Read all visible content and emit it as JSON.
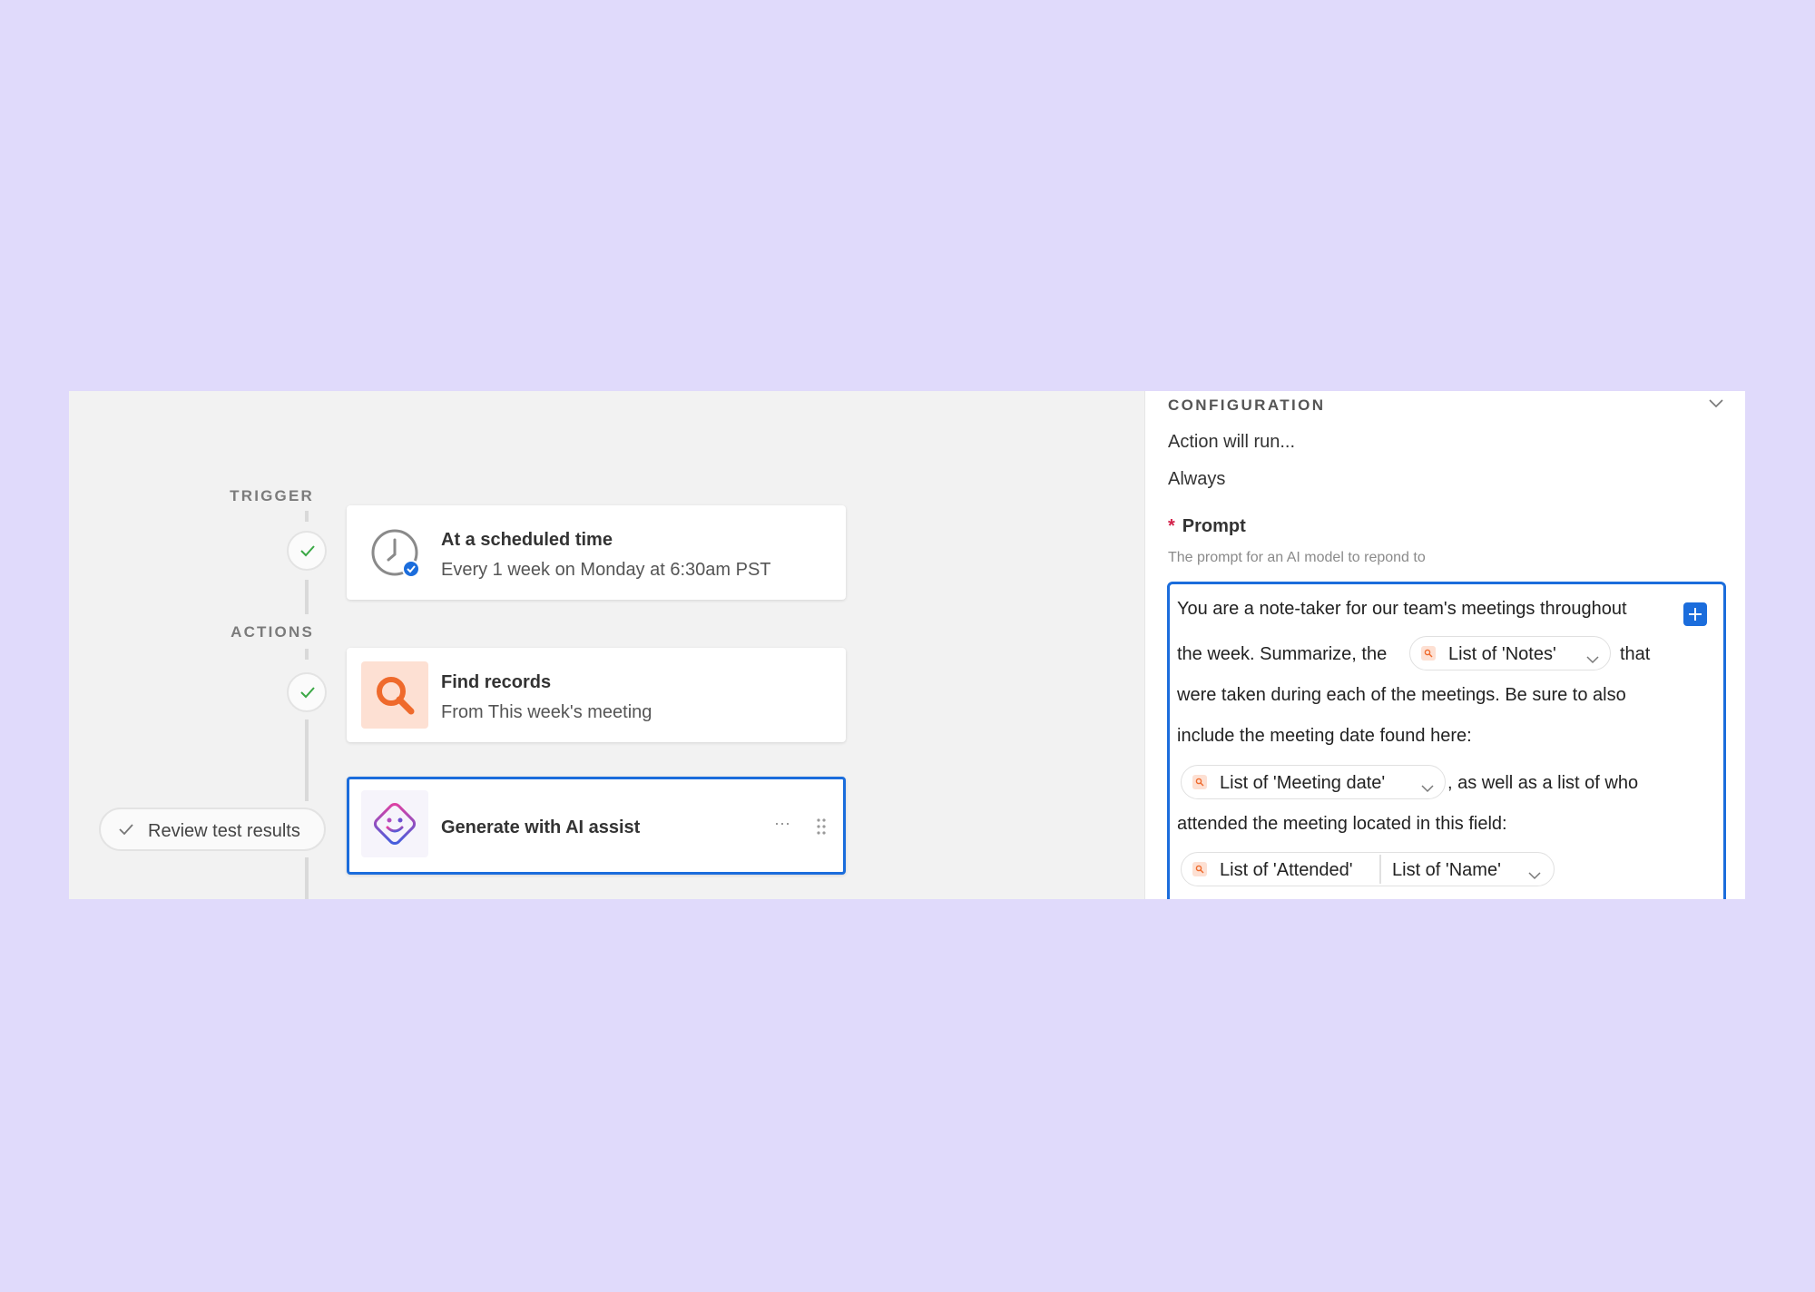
{
  "workflow": {
    "trigger_label": "TRIGGER",
    "actions_label": "ACTIONS",
    "trigger_card": {
      "title": "At a scheduled time",
      "subtitle": "Every 1 week on Monday at 6:30am PST",
      "icon": "clock-icon"
    },
    "find_card": {
      "title": "Find records",
      "subtitle": "From This week's meeting",
      "icon": "search-icon"
    },
    "ai_card": {
      "title": "Generate with AI assist",
      "icon": "ai-smile-icon",
      "more": "···"
    },
    "review_button": "Review test results"
  },
  "panel": {
    "section_title": "CONFIGURATION",
    "run_label": "Action will run...",
    "run_value": "Always",
    "prompt_required": "*",
    "prompt_label": "Prompt",
    "prompt_help": "The prompt for an AI model to repond to",
    "prompt_lines": {
      "l1": "You are a note-taker for our team's meetings throughout",
      "l2a": "the week. Summarize, the",
      "l2b": "that",
      "l3": "were taken during each of the meetings. Be sure to also",
      "l4": "include the meeting date found here:",
      "l5b": ", as well as a list of who",
      "l6": "attended the meeting located in this field:"
    },
    "tokens": {
      "notes": "List of 'Notes'",
      "meeting_date": "List of 'Meeting date'",
      "attended": "List of 'Attended'",
      "name": "List of 'Name'"
    }
  },
  "colors": {
    "page_bg": "#e0dafb",
    "accent": "#1b6ddc",
    "required": "#d3224a",
    "find_icon_bg": "#fde0d3",
    "find_icon": "#ef6a2c",
    "success": "#3aa845"
  }
}
